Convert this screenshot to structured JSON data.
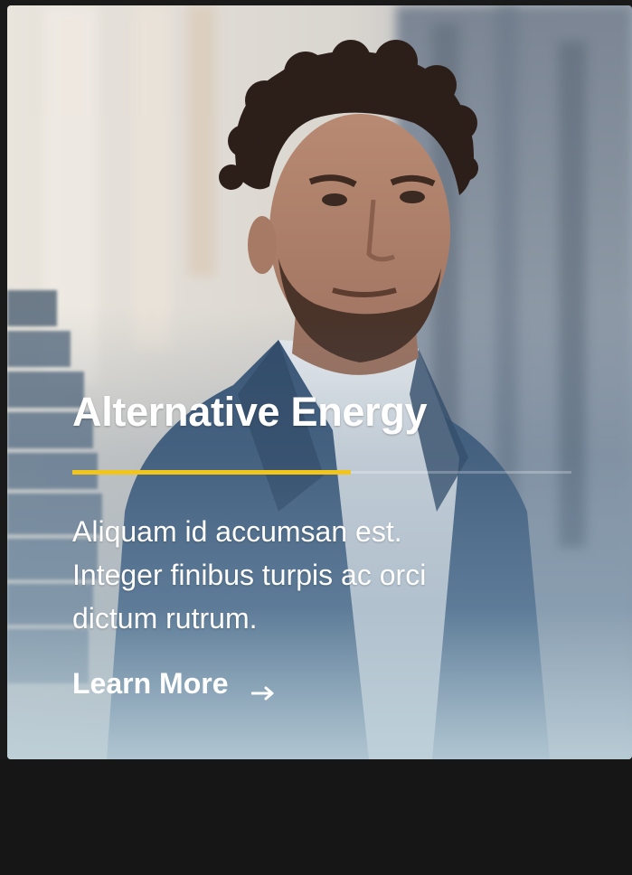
{
  "card": {
    "title": "Alternative Energy",
    "description": "Aliquam id accumsan est. Integer finibus turpis ac orci dictum rutrum.",
    "cta_label": "Learn More",
    "cta_icon": "arrow-right-icon",
    "accent_color": "#f2c51c",
    "image_subject": "portrait-photo"
  }
}
